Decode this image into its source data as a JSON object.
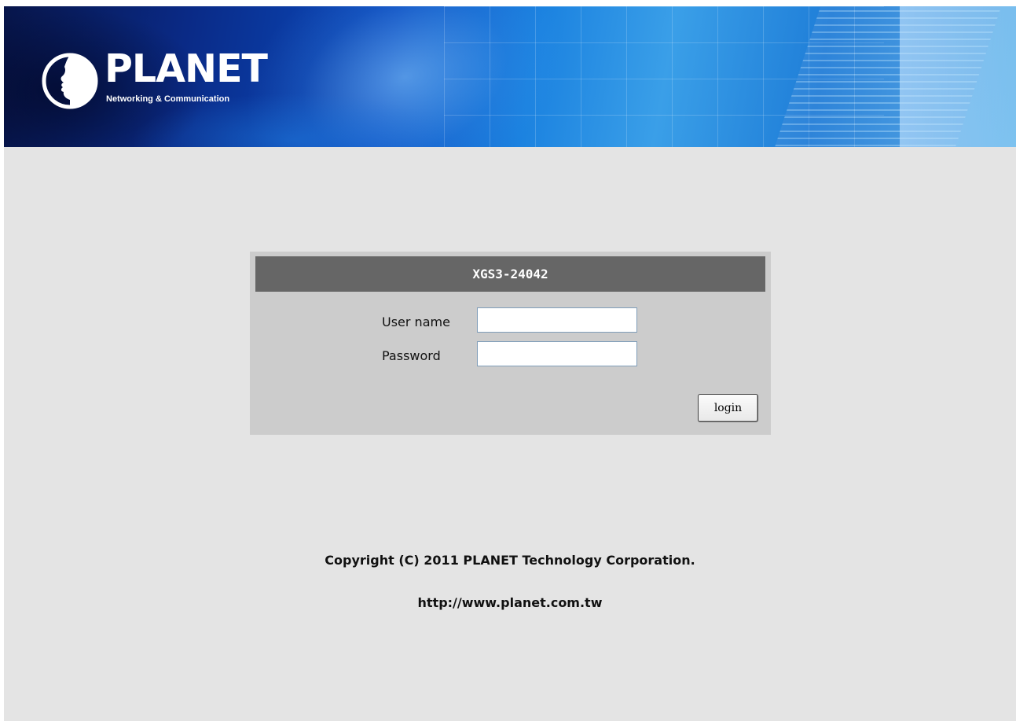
{
  "header": {
    "brand": "PLANET",
    "tagline": "Networking & Communication",
    "logo_icon": "planet-face-logo-icon"
  },
  "login": {
    "title": "XGS3-24042",
    "username_label": "User name",
    "username_value": "",
    "password_label": "Password",
    "password_value": "",
    "button_label": "login"
  },
  "footer": {
    "copyright": "Copyright (C) 2011 PLANET Technology Corporation.",
    "url": "http://www.planet.com.tw"
  },
  "colors": {
    "page_background": "#e4e4e4",
    "box_background": "#cccccc",
    "title_bar": "#666666",
    "banner_blue": "#1b82e0"
  }
}
